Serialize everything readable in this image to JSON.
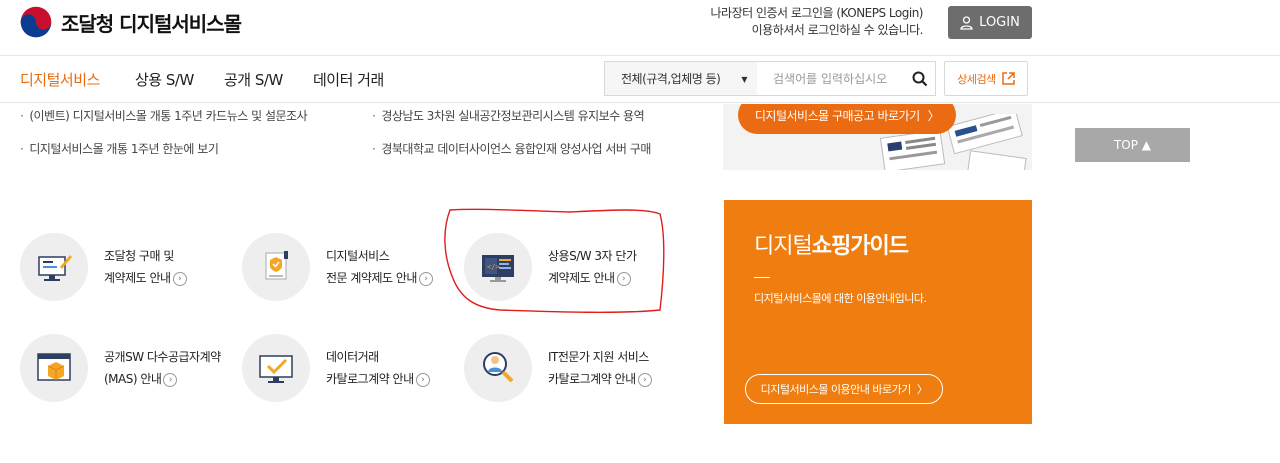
{
  "header": {
    "logo_text": "조달청 디지털서비스몰",
    "login_note_line1": "나라장터 인증서 로그인을 (KONEPS Login)",
    "login_note_line2": "이용하셔서 로그인하실 수 있습니다.",
    "login_label": "LOGIN"
  },
  "nav": {
    "items": [
      "디지털서비스",
      "상용 S/W",
      "공개 S/W",
      "데이터 거래"
    ],
    "active_index": 0
  },
  "search": {
    "category_selected": "전체(규격,업체명 등)",
    "placeholder": "검색어를 입력하십시오",
    "detail_label": "상세검색"
  },
  "notices": [
    "(이벤트) 디지털서비스몰 개통 1주년 카드뉴스 및 설문조사",
    "경상남도 3차원 실내공간정보관리시스템 유지보수 용역",
    "디지털서비스몰 개통 1주년 한눈에 보기",
    "경북대학교 데이터사이언스 융합인재 양성사업 서버 구매"
  ],
  "banner": {
    "pill_label": "디지털서비스몰 구매공고 바로가기"
  },
  "top_label": "TOP ▲",
  "services": [
    {
      "line1": "조달청 구매 및",
      "line2": "계약제도 안내"
    },
    {
      "line1": "디지털서비스",
      "line2": "전문 계약제도 안내"
    },
    {
      "line1": "상용S/W 3자 단가",
      "line2": "계약제도 안내"
    },
    {
      "line1": "공개SW 다수공급자계약",
      "line2": "(MAS) 안내"
    },
    {
      "line1": "데이터거래",
      "line2": "카탈로그계약 안내"
    },
    {
      "line1": "IT전문가 지원 서비스",
      "line2": "카탈로그계약 안내"
    }
  ],
  "guide": {
    "title_light": "디지털",
    "title_bold": "쇼핑가이드",
    "desc": "디지털서비스몰에 대한 이용안내입니다.",
    "button_label": "디지털서비스몰 이용안내 바로가기"
  },
  "colors": {
    "accent": "#ea6b11",
    "guide_bg": "#f07d0f",
    "login_bg": "#6d6d6d",
    "top_bg": "#a8a8a8",
    "annotation_red": "#e31b1b"
  }
}
